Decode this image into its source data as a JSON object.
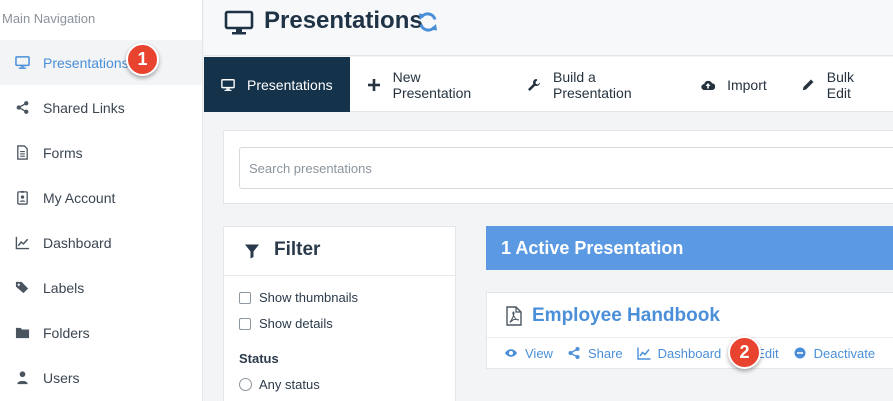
{
  "sidebar": {
    "heading": "Main Navigation",
    "items": [
      {
        "label": "Presentations",
        "icon": "monitor-icon",
        "active": true
      },
      {
        "label": "Shared Links",
        "icon": "share-icon"
      },
      {
        "label": "Forms",
        "icon": "form-icon"
      },
      {
        "label": "My Account",
        "icon": "badge-icon"
      },
      {
        "label": "Dashboard",
        "icon": "line-chart-icon"
      },
      {
        "label": "Labels",
        "icon": "tags-icon"
      },
      {
        "label": "Folders",
        "icon": "folder-icon"
      },
      {
        "label": "Users",
        "icon": "user-icon"
      }
    ]
  },
  "callouts": {
    "first": "1",
    "second": "2"
  },
  "header": {
    "title": "Presentations",
    "title_icon": "monitor-icon",
    "refresh_icon": "refresh-icon"
  },
  "toolbar": {
    "presentations": "Presentations",
    "new_presentation": "New Presentation",
    "build_presentation": "Build a Presentation",
    "import": "Import",
    "bulk_edit": "Bulk Edit"
  },
  "search": {
    "placeholder": "Search presentations",
    "value": ""
  },
  "filter": {
    "title": "Filter",
    "show_thumbnails": "Show thumbnails",
    "show_details": "Show details",
    "status_heading": "Status",
    "any_status": "Any status"
  },
  "results": {
    "banner": "1 Active Presentation"
  },
  "presentation": {
    "title": "Employee Handbook",
    "actions": {
      "view": "View",
      "share": "Share",
      "dashboard": "Dashboard",
      "edit": "Edit",
      "deactivate": "Deactivate"
    }
  },
  "colors": {
    "accent": "#4a8fd8",
    "toolbar_active": "#14324a",
    "banner": "#5b9ae3",
    "callout": "#e8432f"
  }
}
